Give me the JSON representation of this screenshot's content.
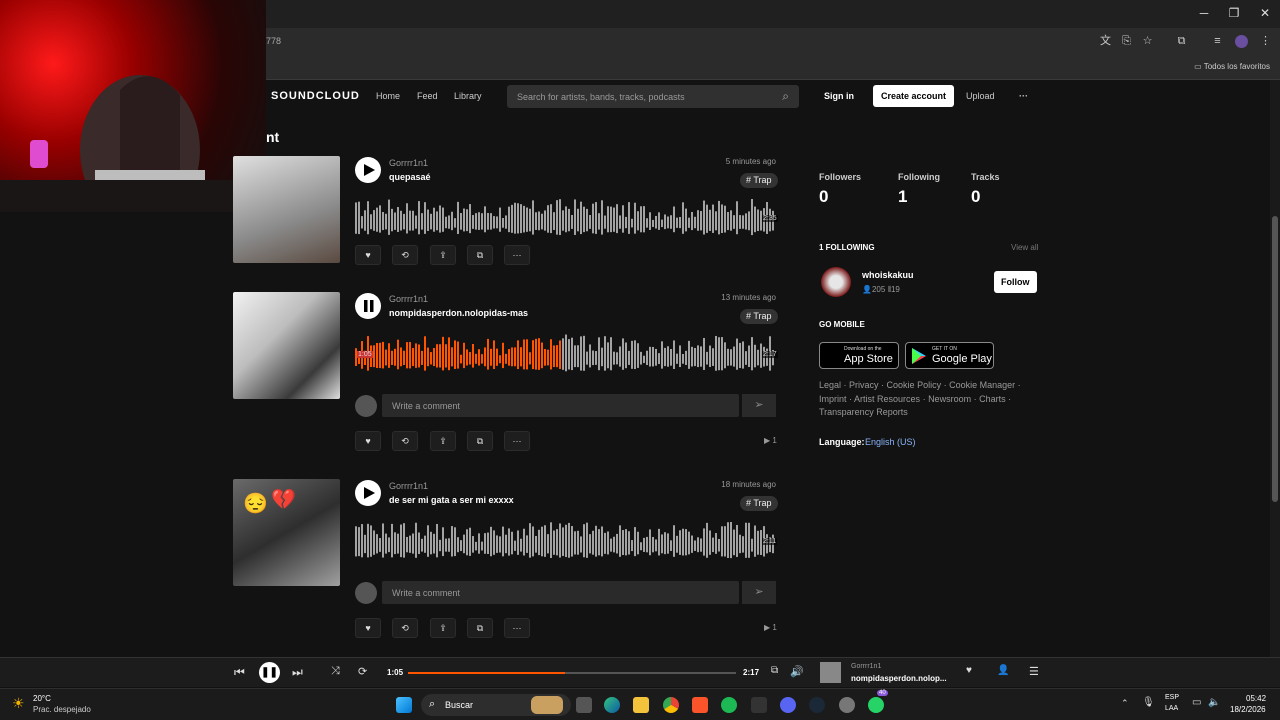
{
  "browser": {
    "url_fragment": "778",
    "bookmarks_folder": "Todos los favoritos",
    "window_controls": [
      "minimize",
      "maximize",
      "close"
    ]
  },
  "header": {
    "logo": "SOUNDCLOUD",
    "nav": [
      "Home",
      "Feed",
      "Library"
    ],
    "search_placeholder": "Search for artists, bands, tracks, podcasts",
    "sign_in": "Sign in",
    "create_account": "Create account",
    "upload": "Upload",
    "more": "···"
  },
  "section_title": "nt",
  "tracks": [
    {
      "artist": "Gorrrr1n1",
      "title": "quepasaé",
      "ago": "5 minutes ago",
      "tag": "# Trap",
      "duration": "2:35",
      "state": "paused",
      "progress": 0,
      "art_color": "#bdbdbd",
      "plays": ""
    },
    {
      "artist": "Gorrrr1n1",
      "title": "nompidasperdon.nolopidas-mas",
      "ago": "13 minutes ago",
      "tag": "# Trap",
      "duration": "2:17",
      "elapsed": "1:05",
      "state": "playing",
      "progress": 0.49,
      "art_color": "#d9d9d9",
      "plays": "1",
      "comment_placeholder": "Write a comment"
    },
    {
      "artist": "Gorrrr1n1",
      "title": "de ser mi gata a ser mi exxxx",
      "ago": "18 minutes ago",
      "tag": "# Trap",
      "duration": "2:11",
      "state": "paused",
      "progress": 0,
      "art_color": "#9c9c9c",
      "plays": "1",
      "comment_placeholder": "Write a comment"
    }
  ],
  "sidebar": {
    "stats": [
      {
        "label": "Followers",
        "value": "0"
      },
      {
        "label": "Following",
        "value": "1"
      },
      {
        "label": "Tracks",
        "value": "0"
      }
    ],
    "following_header": "1 FOLLOWING",
    "view_all": "View all",
    "followed_user": {
      "name": "whoiskakuu",
      "followers": "205",
      "tracks": "19",
      "follow_label": "Follow"
    },
    "go_mobile": "GO MOBILE",
    "app_store": {
      "small": "Download on the",
      "big": "App Store"
    },
    "google_play": {
      "small": "GET IT ON",
      "big": "Google Play"
    },
    "footer_links": [
      "Legal",
      "Privacy",
      "Cookie Policy",
      "Cookie Manager",
      "Imprint",
      "Artist Resources",
      "Newsroom",
      "Charts",
      "Transparency Reports"
    ],
    "language_label": "Language:",
    "language_value": "English (US)"
  },
  "player": {
    "elapsed": "1:05",
    "duration": "2:17",
    "progress": 0.48,
    "artist": "Gorrrr1n1",
    "title": "nompidasperdon.nolop..."
  },
  "taskbar": {
    "weather_temp": "20°C",
    "weather_desc": "Prac. despejado",
    "search_label": "Buscar",
    "lang": "ESP",
    "lang2": "LAA",
    "time": "05:42",
    "date": "18/2/2026",
    "badge": "40"
  },
  "colors": {
    "accent": "#ff5500",
    "bg": "#121212"
  }
}
